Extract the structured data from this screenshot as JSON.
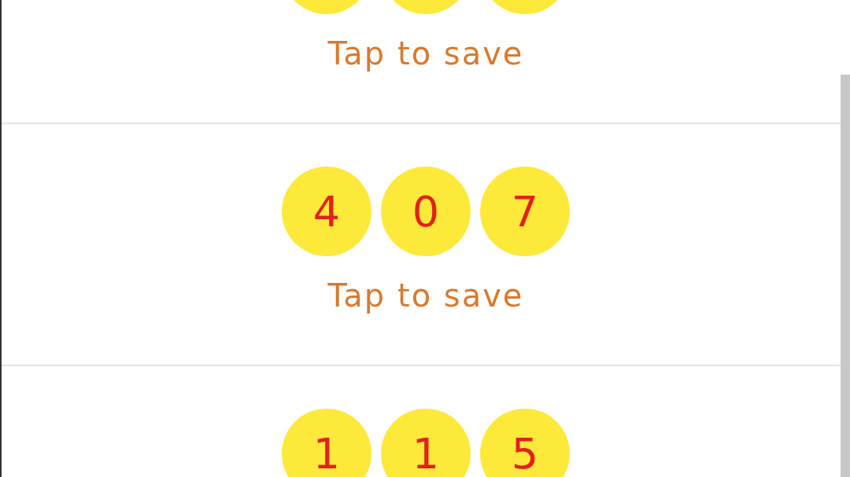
{
  "rows": [
    {
      "balls": [
        {
          "kind": "blank"
        },
        {
          "kind": "blank"
        },
        {
          "kind": "blank"
        }
      ],
      "action": "Tap to save"
    },
    {
      "balls": [
        {
          "kind": "digit",
          "digit": "4"
        },
        {
          "kind": "digit",
          "digit": "0"
        },
        {
          "kind": "digit",
          "digit": "7"
        }
      ],
      "action": "Tap to save"
    },
    {
      "balls": [
        {
          "kind": "digit",
          "digit": "1"
        },
        {
          "kind": "digit",
          "digit": "1"
        },
        {
          "kind": "digit",
          "digit": "5"
        }
      ]
    }
  ]
}
